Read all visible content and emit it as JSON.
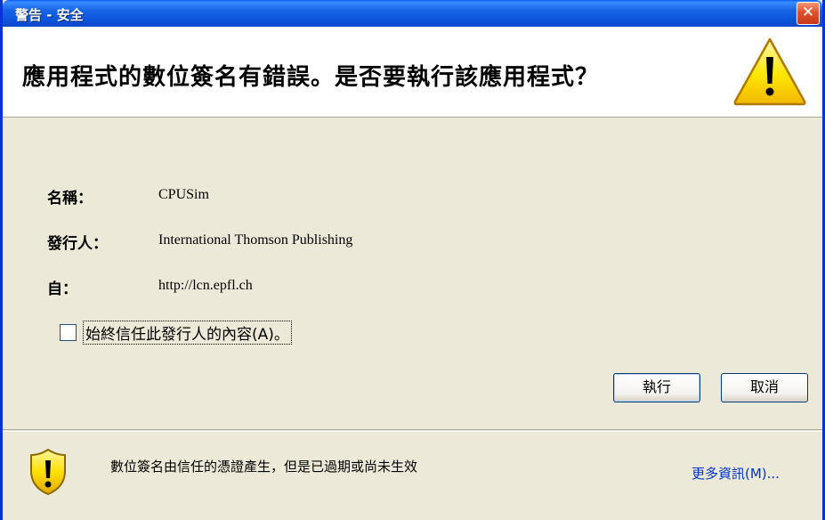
{
  "window": {
    "title": "警告 - 安全",
    "close_glyph": "✕"
  },
  "header": {
    "question": "應用程式的數位簽名有錯誤。是否要執行該應用程式？",
    "icon": "warning-triangle-icon"
  },
  "details": {
    "name_label": "名稱：",
    "name_value": "CPUSim",
    "publisher_label": "發行人：",
    "publisher_value": "International Thomson Publishing",
    "from_label": "自：",
    "from_value": "http://lcn.epfl.ch"
  },
  "trust_checkbox": {
    "label": "始終信任此發行人的內容(A)。",
    "checked": false
  },
  "buttons": {
    "run_label": "執行",
    "cancel_label": "取消"
  },
  "footer": {
    "icon": "warning-shield-icon",
    "message": "數位簽名由信任的憑證產生，但是已過期或尚未生效",
    "more_info_label": "更多資訊(M)..."
  },
  "colors": {
    "titlebar": "#0b4fd8",
    "dialog_bg": "#ece9d8",
    "link": "#0033cc",
    "warning_yellow": "#ffe600",
    "close_red": "#e0502a"
  }
}
